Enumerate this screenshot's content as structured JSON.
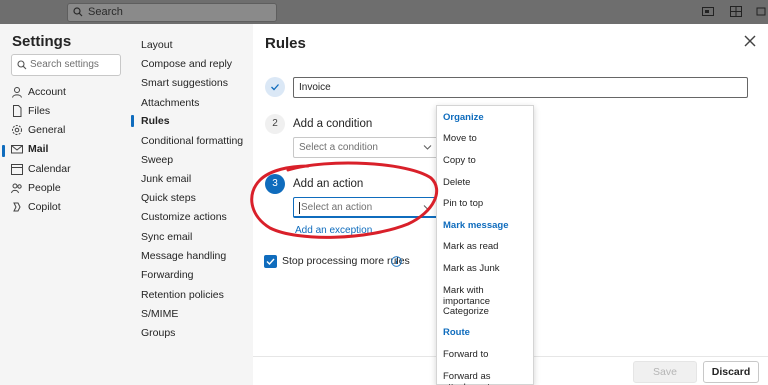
{
  "topbar": {
    "search_placeholder": "Search"
  },
  "settings": {
    "title": "Settings",
    "search_placeholder": "Search settings",
    "nav": [
      {
        "label": "Account",
        "icon": "person-icon"
      },
      {
        "label": "Files",
        "icon": "file-icon"
      },
      {
        "label": "General",
        "icon": "gear-icon"
      },
      {
        "label": "Mail",
        "icon": "mail-icon"
      },
      {
        "label": "Calendar",
        "icon": "calendar-icon"
      },
      {
        "label": "People",
        "icon": "people-icon"
      },
      {
        "label": "Copilot",
        "icon": "copilot-icon"
      }
    ],
    "active_nav": "Mail"
  },
  "mail_sections": [
    "Layout",
    "Compose and reply",
    "Smart suggestions",
    "Attachments",
    "Rules",
    "Conditional formatting",
    "Sweep",
    "Junk email",
    "Quick steps",
    "Customize actions",
    "Sync email",
    "Message handling",
    "Forwarding",
    "Retention policies",
    "S/MIME",
    "Groups"
  ],
  "active_section": "Rules",
  "rules": {
    "title": "Rules",
    "rule_name_value": "Invoice",
    "step2": {
      "number": "2",
      "label": "Add a condition",
      "select_placeholder": "Select a condition"
    },
    "step3": {
      "number": "3",
      "label": "Add an action",
      "select_placeholder": "Select an action"
    },
    "add_exception": "Add an exception",
    "stop_processing_label": "Stop processing more rules",
    "stop_processing_checked": true,
    "save_label": "Save",
    "discard_label": "Discard"
  },
  "action_menu": [
    {
      "type": "header",
      "label": "Organize"
    },
    {
      "type": "item",
      "label": "Move to"
    },
    {
      "type": "item",
      "label": "Copy to"
    },
    {
      "type": "item",
      "label": "Delete"
    },
    {
      "type": "item",
      "label": "Pin to top"
    },
    {
      "type": "header",
      "label": "Mark message"
    },
    {
      "type": "item",
      "label": "Mark as read"
    },
    {
      "type": "item",
      "label": "Mark as Junk"
    },
    {
      "type": "item",
      "label": "Mark with importance"
    },
    {
      "type": "item",
      "label": "Categorize"
    },
    {
      "type": "header",
      "label": "Route"
    },
    {
      "type": "item",
      "label": "Forward to"
    },
    {
      "type": "item",
      "label": "Forward as attachment"
    }
  ],
  "colors": {
    "accent": "#0f6cbd",
    "annotation": "#d9202a"
  }
}
